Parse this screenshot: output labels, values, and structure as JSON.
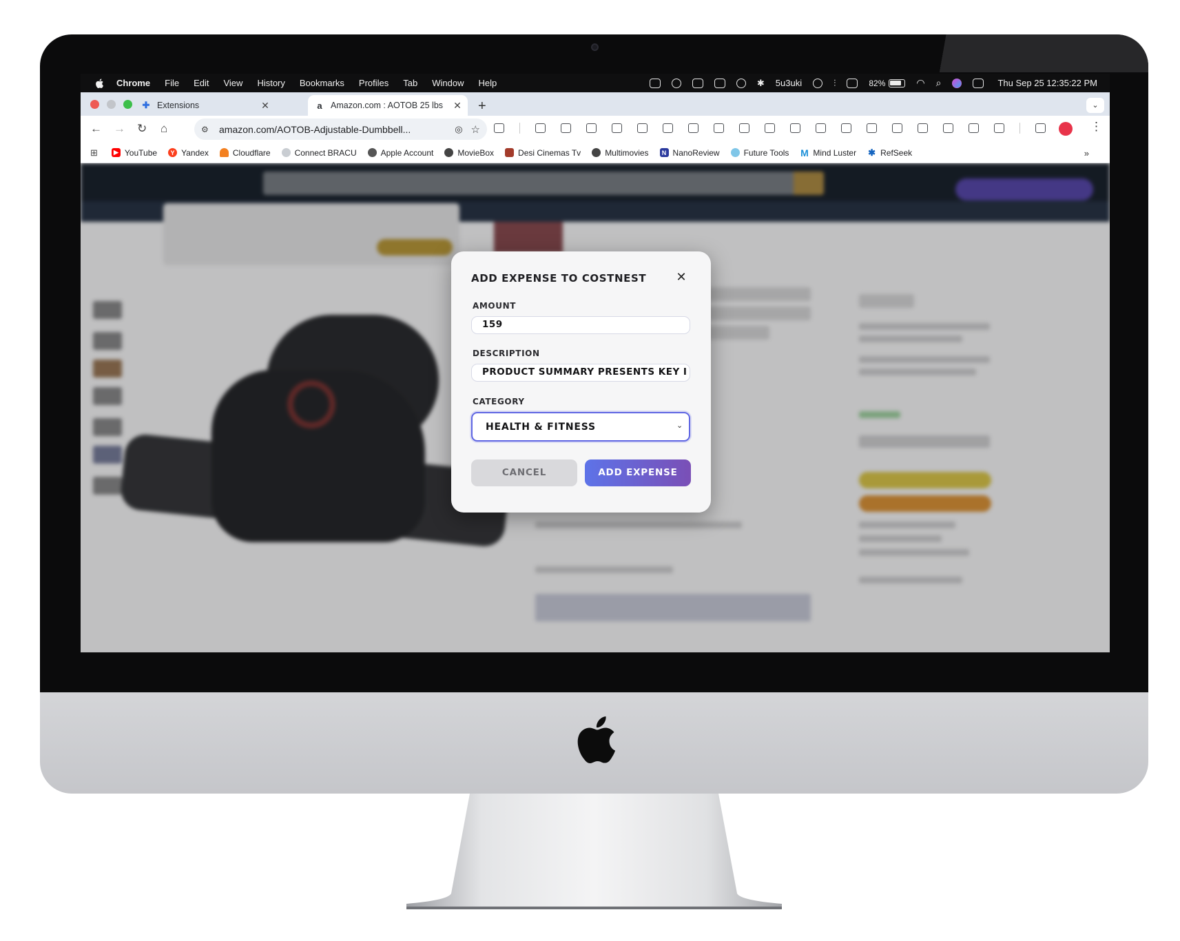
{
  "menubar": {
    "app_name": "Chrome",
    "menus": [
      "File",
      "Edit",
      "View",
      "History",
      "Bookmarks",
      "Profiles",
      "Tab",
      "Window",
      "Help"
    ],
    "user": "5u3uki",
    "battery": "82%",
    "datetime": "Thu Sep 25  12:35:22 PM"
  },
  "tabs": [
    {
      "title": "Extensions",
      "icon": "puzzle-icon"
    },
    {
      "title": "Amazon.com : AOTOB 25 lbs",
      "icon": "amazon-icon"
    }
  ],
  "toolbar": {
    "url": "amazon.com/AOTOB-Adjustable-Dumbbell..."
  },
  "bookmarks": [
    {
      "label": "YouTube",
      "color": "#ff0000"
    },
    {
      "label": "Yandex",
      "color": "#fc3f1d"
    },
    {
      "label": "Cloudflare",
      "color": "#f38020"
    },
    {
      "label": "Connect BRACU",
      "color": "#9aa0a6"
    },
    {
      "label": "Apple Account",
      "color": "#555555"
    },
    {
      "label": "MovieBox",
      "color": "#444444"
    },
    {
      "label": "Desi Cinemas Tv",
      "color": "#a33b2b"
    },
    {
      "label": "Multimovies",
      "color": "#444444"
    },
    {
      "label": "NanoReview",
      "color": "#2b3a9e"
    },
    {
      "label": "Future Tools",
      "color": "#7fc6e8"
    },
    {
      "label": "Mind Luster",
      "color": "#1a8fd8"
    },
    {
      "label": "RefSeek",
      "color": "#1565c0"
    }
  ],
  "modal": {
    "title": "Add Expense to CostNest",
    "amount_label": "Amount",
    "amount_value": "159",
    "description_label": "Description",
    "description_value": "Product summary presents key i",
    "category_label": "Category",
    "category_value": "Health & Fitness",
    "cancel_label": "Cancel",
    "add_label": "Add Expense",
    "accent_color": "#5f66e3"
  }
}
